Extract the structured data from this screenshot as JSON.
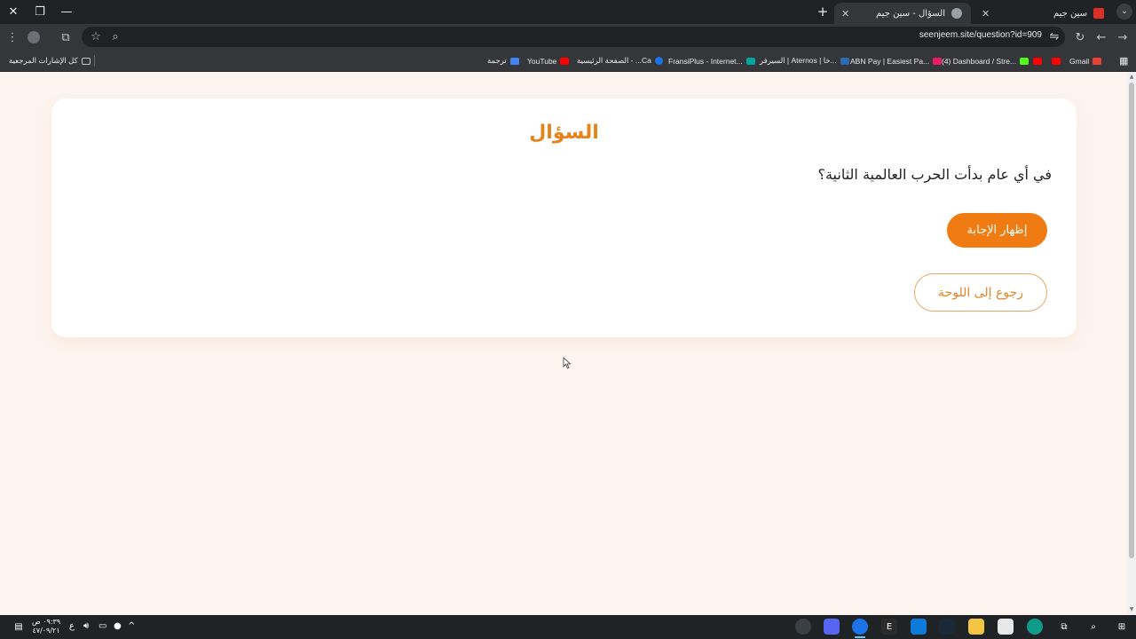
{
  "browser": {
    "tabs": [
      {
        "title": "السؤال - سين جيم",
        "active": true
      },
      {
        "title": "سين جيم",
        "active": false
      }
    ],
    "url": "seenjeem.site/question?id=909"
  },
  "bookmarks": {
    "all_bookmarks": "كل الإشارات المرجعية",
    "items": [
      "ترجمة",
      "YouTube",
      "الصفحة الرئيسية - ...Ca",
      "FransiPlus - Internet...",
      "السيرفر | Aternos | خا...",
      "ABN Pay | Easiest Pa...",
      "(4) Dashboard / Stre...",
      "Gmail"
    ]
  },
  "card": {
    "title": "السؤال",
    "question": "في أي عام بدأت الحرب العالمية الثانية؟",
    "show_answer": "إظهار الإجابة",
    "back_to_board": "رجوع إلى اللوحة"
  },
  "taskbar": {
    "time": "٠٩:٣٩ ص",
    "date": "٤٧/٠٩/٢١",
    "lang": "ع"
  },
  "colors": {
    "accent": "#f07b12",
    "title": "#e8821a",
    "page_bg": "#fdf4ef"
  }
}
